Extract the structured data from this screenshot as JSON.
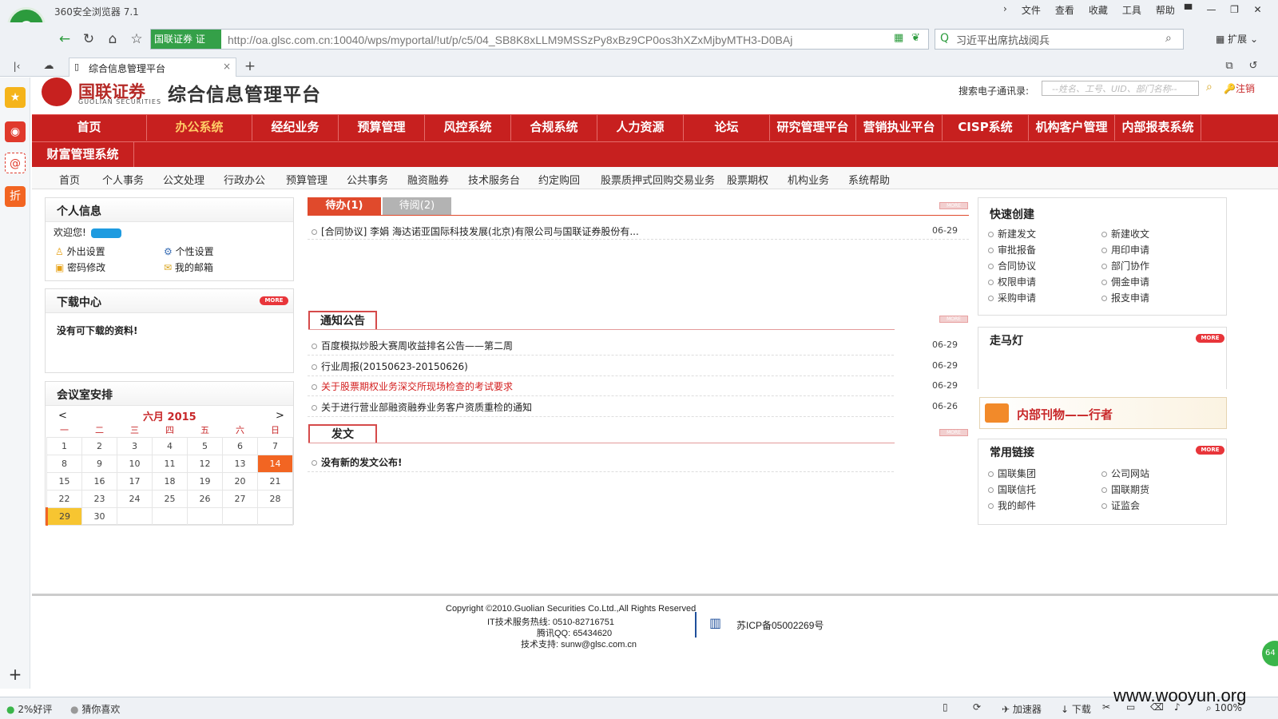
{
  "browser": {
    "title": "360安全浏览器 7.1",
    "menu": [
      "文件",
      "查看",
      "收藏",
      "工具",
      "帮助"
    ],
    "url_badge": "国联证券 证",
    "url": "http://oa.glsc.com.cn:10040/wps/myportal/!ut/p/c5/04_SB8K8xLLM9MSSzPy8xBz9CP0os3hXZxMjbyMTH3-D0BAj",
    "search_value": "习近平出席抗战阅兵",
    "extend_label": "扩展",
    "tab_title": "综合信息管理平台",
    "status_left": [
      "2%好评",
      "猜你喜欢"
    ],
    "status_right": [
      "加速器",
      "下载",
      "100%"
    ]
  },
  "header": {
    "brand_name": "国联证券",
    "brand_en": "GUOLIAN SECURITIES",
    "platform_title": "综合信息管理平台",
    "directory_label": "搜索电子通讯录:",
    "directory_placeholder": "--姓名、工号、UID、部门名称--",
    "logout": "注销"
  },
  "main_nav": [
    "首页",
    "办公系统",
    "经纪业务",
    "预算管理",
    "风控系统",
    "合规系统",
    "人力资源",
    "论坛",
    "研究管理平台",
    "营销执业平台",
    "CISP系统",
    "机构客户管理",
    "内部报表系统",
    "财富管理系统"
  ],
  "main_nav_active": "办公系统",
  "sub_nav": [
    "首页",
    "个人事务",
    "公文处理",
    "行政办公",
    "预算管理",
    "公共事务",
    "融资融券",
    "技术服务台",
    "约定购回",
    "股票质押式回购交易业务",
    "股票期权",
    "机构业务",
    "系统帮助"
  ],
  "personal": {
    "title": "个人信息",
    "welcome": "欢迎您!",
    "links": [
      "外出设置",
      "个性设置",
      "密码修改",
      "我的邮箱"
    ]
  },
  "download": {
    "title": "下载中心",
    "empty": "没有可下载的资料!"
  },
  "meeting": {
    "title": "会议室安排",
    "month_label": "六月 2015",
    "prev": "<",
    "next": ">",
    "weekdays": [
      "一",
      "二",
      "三",
      "四",
      "五",
      "六",
      "日"
    ],
    "weeks": [
      [
        "1",
        "2",
        "3",
        "4",
        "5",
        "6",
        "7"
      ],
      [
        "8",
        "9",
        "10",
        "11",
        "12",
        "13",
        "14"
      ],
      [
        "15",
        "16",
        "17",
        "18",
        "19",
        "20",
        "21"
      ],
      [
        "22",
        "23",
        "24",
        "25",
        "26",
        "27",
        "28"
      ],
      [
        "29",
        "30",
        "",
        "",
        "",
        "",
        ""
      ]
    ],
    "highlight_day": "14",
    "today": "29"
  },
  "todo": {
    "tab_active": "待办(1)",
    "tab_inactive": "待阅(2)",
    "items": [
      {
        "text": "[合同协议] 李娟 海达诺亚国际科技发展(北京)有限公司与国联证券股份有...",
        "date": "06-29"
      }
    ]
  },
  "notice": {
    "title": "通知公告",
    "items": [
      {
        "text": "百度模拟炒股大赛周收益排名公告——第二周",
        "date": "06-29",
        "highlight": false
      },
      {
        "text": "行业周报(20150623-20150626)",
        "date": "06-29",
        "highlight": false
      },
      {
        "text": "关于股票期权业务深交所现场检查的考试要求",
        "date": "06-29",
        "highlight": true
      },
      {
        "text": "关于进行营业部融资融券业务客户资质重检的通知",
        "date": "06-26",
        "highlight": false
      }
    ]
  },
  "dispatch": {
    "title": "发文",
    "empty": "没有新的发文公布!"
  },
  "quick_create": {
    "title": "快速创建",
    "items": [
      "新建发文",
      "新建收文",
      "审批报备",
      "用印申请",
      "合同协议",
      "部门协作",
      "权限申请",
      "佣金申请",
      "采购申请",
      "报支申请"
    ]
  },
  "marquee": {
    "title": "走马灯"
  },
  "journal": {
    "label": "内部刊物——行者"
  },
  "links": {
    "title": "常用链接",
    "items": [
      "国联集团",
      "公司网站",
      "国联信托",
      "国联期货",
      "我的邮件",
      "证监会"
    ]
  },
  "more_label": "MORE",
  "footer": {
    "copyright": "Copyright ©2010.Guolian Securities Co.Ltd.,All Rights Reserved",
    "hotline": "IT技术服务热线: 0510-82716751",
    "qq": "腾讯QQ: 65434620",
    "support": "技术支持: sunw@glsc.com.cn",
    "icp": "苏ICP备05002269号"
  },
  "watermark": "www.wooyun.org",
  "colors": {
    "brand_red": "#c7201f",
    "accent_orange": "#f26522",
    "browser_green": "#34a048"
  }
}
